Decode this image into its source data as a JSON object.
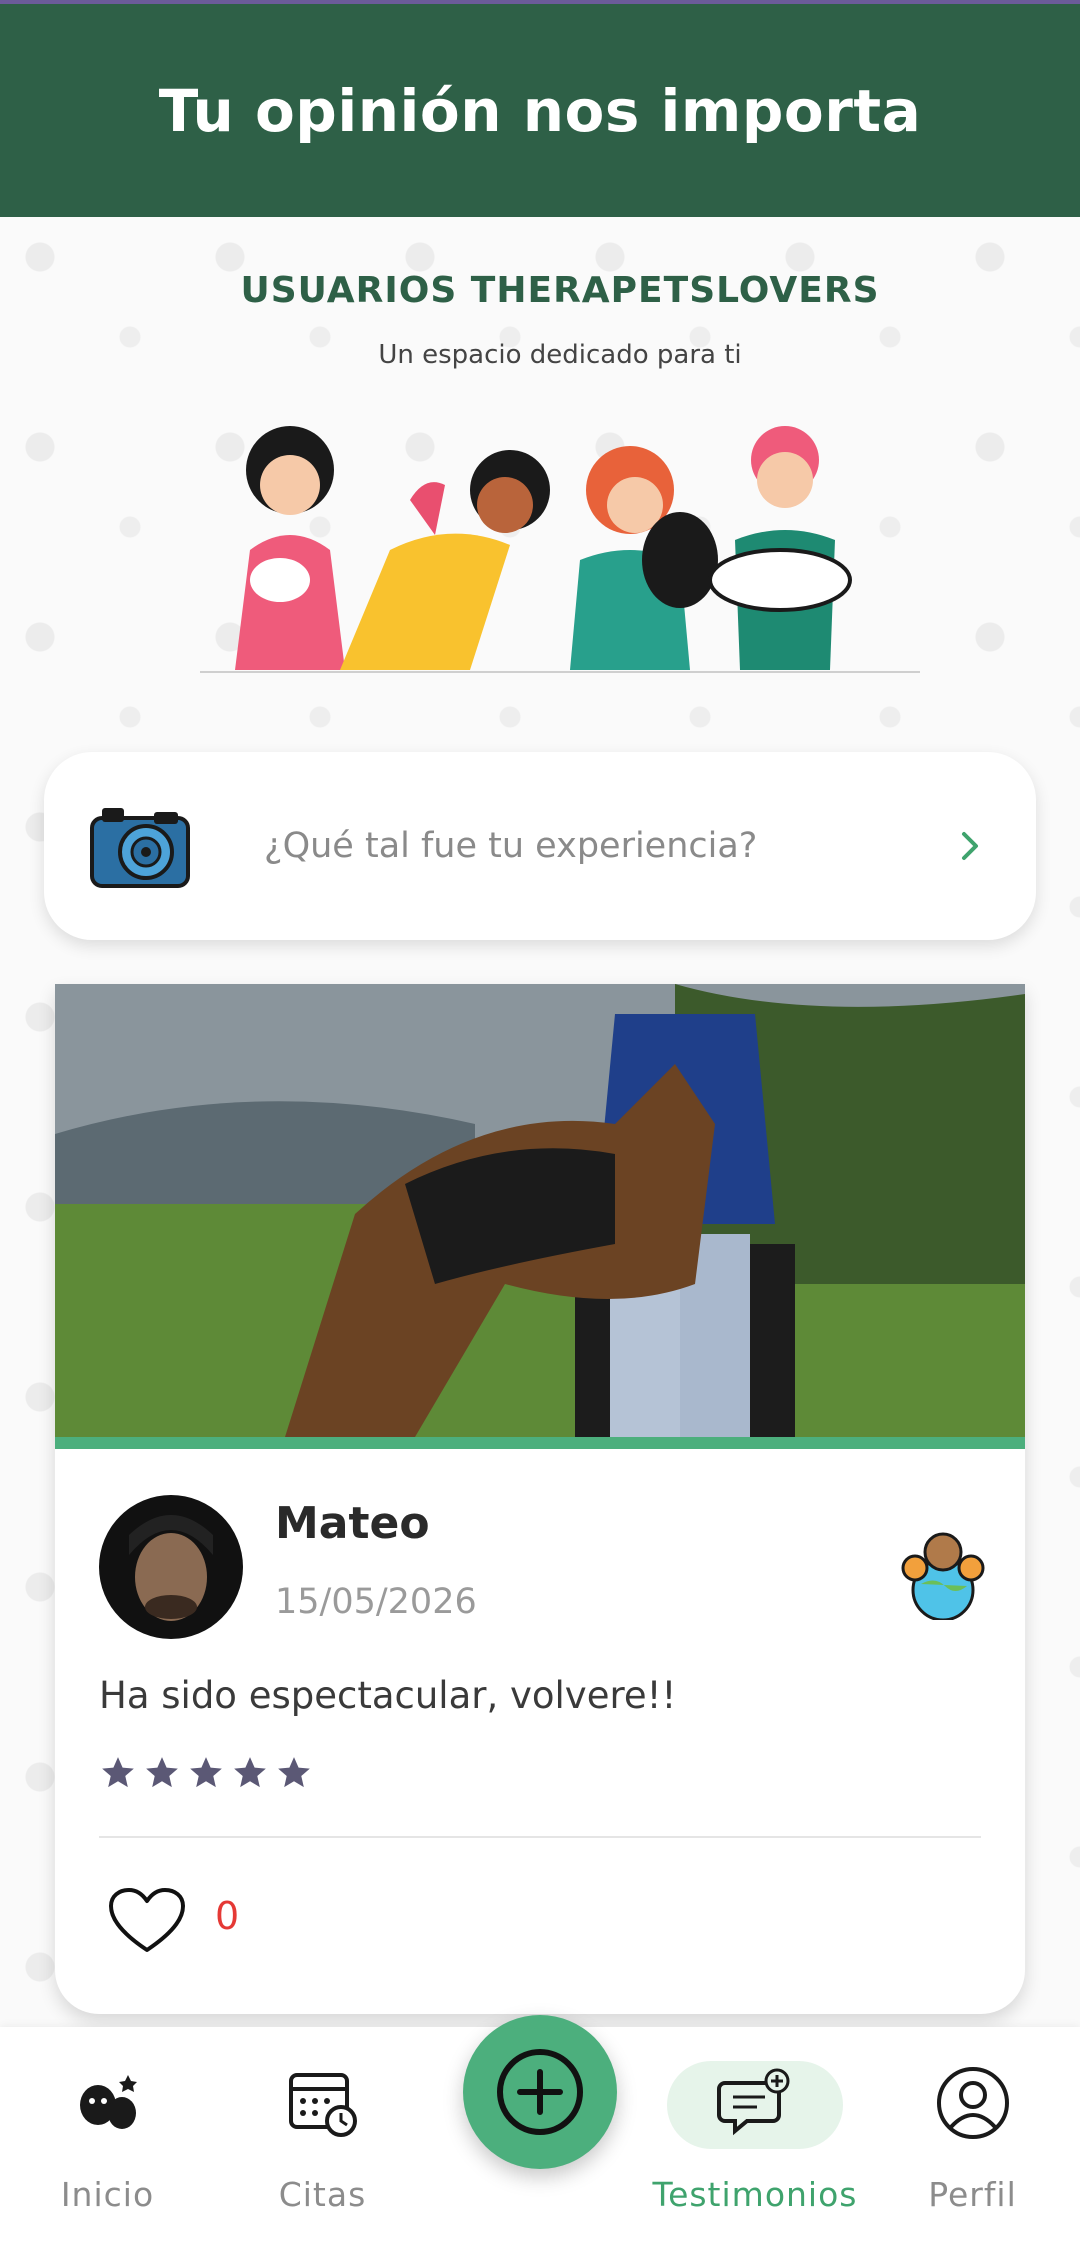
{
  "header": {
    "title": "Tu opinión nos importa"
  },
  "banner": {
    "title": "USUARIOS THERAPETSLOVERS",
    "subtitle": "Un espacio dedicado para ti"
  },
  "experience": {
    "placeholder": "¿Qué tal fue tu experiencia?",
    "camera_icon": "camera-icon",
    "arrow_icon": "chevron-right-icon"
  },
  "testimonial": {
    "name": "Mateo",
    "date": "15/05/2026",
    "comment": "Ha sido espectacular, volvere!!",
    "rating": 5,
    "likes": "0"
  },
  "nav": {
    "items": [
      {
        "label": "Inicio",
        "icon": "pets-icon"
      },
      {
        "label": "Citas",
        "icon": "calendar-icon"
      },
      {
        "label": "Testimonios",
        "icon": "chat-icon"
      },
      {
        "label": "Perfil",
        "icon": "user-icon"
      }
    ],
    "fab_icon": "plus-circle-icon"
  },
  "colors": {
    "header": "#2e6047",
    "accent": "#4caf7d",
    "active_pill": "#e6f4ea",
    "like_count": "#e53935"
  }
}
